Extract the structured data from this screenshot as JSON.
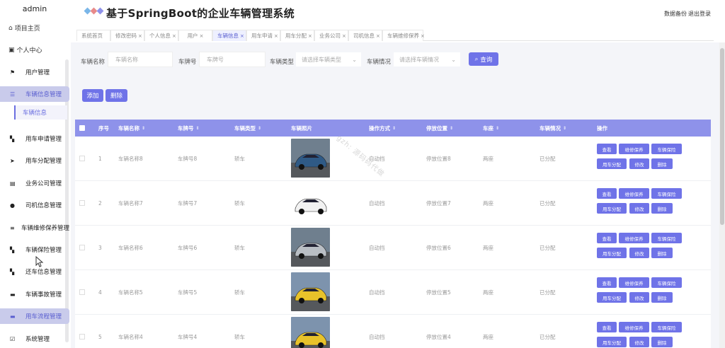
{
  "sidebar": {
    "user": "admin",
    "top_items": [
      {
        "label": "项目主页",
        "icon": "home-icon"
      },
      {
        "label": "个人中心",
        "icon": "user-card-icon"
      }
    ],
    "items": [
      {
        "label": "用户管理",
        "icon": "flag-icon"
      },
      {
        "label": "车辆信息管理",
        "icon": "menu-icon"
      },
      {
        "label": "用车申请管理",
        "icon": "grid-icon"
      },
      {
        "label": "用车分配管理",
        "icon": "send-icon"
      },
      {
        "label": "业务公司管理",
        "icon": "chart-icon"
      },
      {
        "label": "司机信息管理",
        "icon": "person-icon"
      },
      {
        "label": "车辆维修保养管理",
        "icon": "sliders-icon"
      },
      {
        "label": "车辆保险管理",
        "icon": "grid-icon"
      },
      {
        "label": "还车信息管理",
        "icon": "grid-icon"
      },
      {
        "label": "车辆事故管理",
        "icon": "monitor-icon"
      },
      {
        "label": "用车流程管理",
        "icon": "monitor-icon"
      },
      {
        "label": "系统管理",
        "icon": "checkbox-icon"
      }
    ],
    "sub_item": "车辆信息"
  },
  "header": {
    "title": "基于SpringBoot的企业车辆管理系统",
    "backup": "数据备份",
    "logout": "退出登录"
  },
  "tabs": [
    {
      "label": "系统首页",
      "closable": false
    },
    {
      "label": "修改密码",
      "closable": true
    },
    {
      "label": "个人信息",
      "closable": true
    },
    {
      "label": "用户",
      "closable": true
    },
    {
      "label": "车辆信息",
      "closable": true,
      "active": true
    },
    {
      "label": "用车申请",
      "closable": true
    },
    {
      "label": "用车分配",
      "closable": true
    },
    {
      "label": "业务公司",
      "closable": true
    },
    {
      "label": "司机信息",
      "closable": true
    },
    {
      "label": "车辆维修保养",
      "closable": true
    }
  ],
  "filters": {
    "name_label": "车辆名称",
    "name_placeholder": "车辆名称",
    "plate_label": "车牌号",
    "plate_placeholder": "车牌号",
    "type_label": "车辆类型",
    "type_placeholder": "请选择车辆类型",
    "status_label": "车辆情况",
    "status_placeholder": "请选择车辆情况",
    "search_label": "查询"
  },
  "actions": {
    "add": "添加",
    "delete": "删除"
  },
  "table": {
    "columns": [
      "序号",
      "车辆名称",
      "车牌号",
      "车辆类型",
      "车辆照片",
      "操作方式",
      "停放位置",
      "车座",
      "车辆情况",
      "操作"
    ],
    "rows": [
      {
        "no": "1",
        "name": "车辆名称8",
        "plate": "车牌号8",
        "type": "轿车",
        "trans": "自动挡",
        "parking": "停放位置8",
        "seats": "两座",
        "status": "已分配",
        "photo_color": "#2f5a86"
      },
      {
        "no": "2",
        "name": "车辆名称7",
        "plate": "车牌号7",
        "type": "轿车",
        "trans": "自动挡",
        "parking": "停放位置7",
        "seats": "两座",
        "status": "已分配",
        "photo_color": "#f2f2f2"
      },
      {
        "no": "3",
        "name": "车辆名称6",
        "plate": "车牌号6",
        "type": "轿车",
        "trans": "自动挡",
        "parking": "停放位置6",
        "seats": "两座",
        "status": "已分配",
        "photo_color": "#b9bec4"
      },
      {
        "no": "4",
        "name": "车辆名称5",
        "plate": "车牌号5",
        "type": "轿车",
        "trans": "自动挡",
        "parking": "停放位置5",
        "seats": "两座",
        "status": "已分配",
        "photo_color": "#e8c22a"
      },
      {
        "no": "5",
        "name": "车辆名称4",
        "plate": "车牌号4",
        "type": "轿车",
        "trans": "自动挡",
        "parking": "停放位置4",
        "seats": "两座",
        "status": "已分配",
        "photo_color": "#e8c22a"
      }
    ],
    "ops": [
      "查看",
      "维修保养",
      "车辆保险",
      "用车分配",
      "修改",
      "删除"
    ]
  },
  "watermark": "gzh: 源码码代做",
  "colors": {
    "primary": "#6f73e8",
    "header_bg": "#8e92ea",
    "active_menu": "#c9cbeb"
  }
}
